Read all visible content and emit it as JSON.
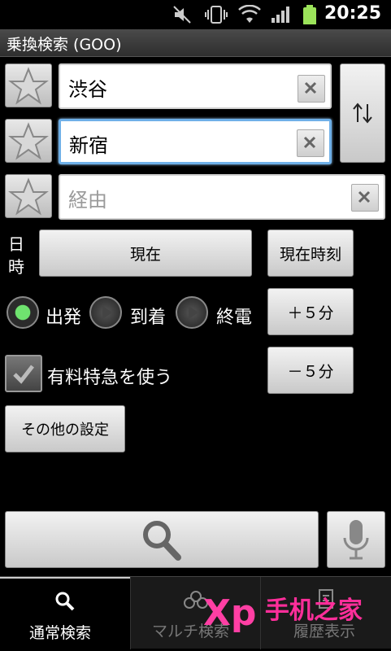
{
  "status_bar": {
    "time": "20:25",
    "icons": [
      "mute-icon",
      "vibrate-icon",
      "wifi-icon",
      "signal-icon",
      "battery-icon"
    ]
  },
  "app": {
    "title": "乗換検索 (GOO)"
  },
  "form": {
    "from": {
      "value": "渋谷"
    },
    "to": {
      "value": "新宿"
    },
    "via": {
      "placeholder": "経由"
    },
    "datetime_label": "日\n時",
    "datetime_value": "現在",
    "now_button": "現在時刻",
    "plus_button": "＋５分",
    "minus_button": "－５分",
    "radio_options": [
      {
        "label": "出発",
        "selected": true
      },
      {
        "label": "到着",
        "selected": false
      },
      {
        "label": "終電",
        "selected": false
      }
    ],
    "express_checkbox": {
      "label": "有料特急を使う",
      "checked": true
    },
    "other_settings_button": "その他の設定"
  },
  "bottom_tabs": [
    {
      "label": "通常検索",
      "active": true,
      "icon": "search-icon"
    },
    {
      "label": "マルチ検索",
      "active": false,
      "icon": "multi-search-icon"
    },
    {
      "label": "履歴表示",
      "active": false,
      "icon": "history-icon"
    }
  ],
  "watermark": {
    "text": "Xp 手机之家"
  },
  "colors": {
    "accent_focus": "#6fb0e8",
    "radio_on": "#6fe36f"
  }
}
